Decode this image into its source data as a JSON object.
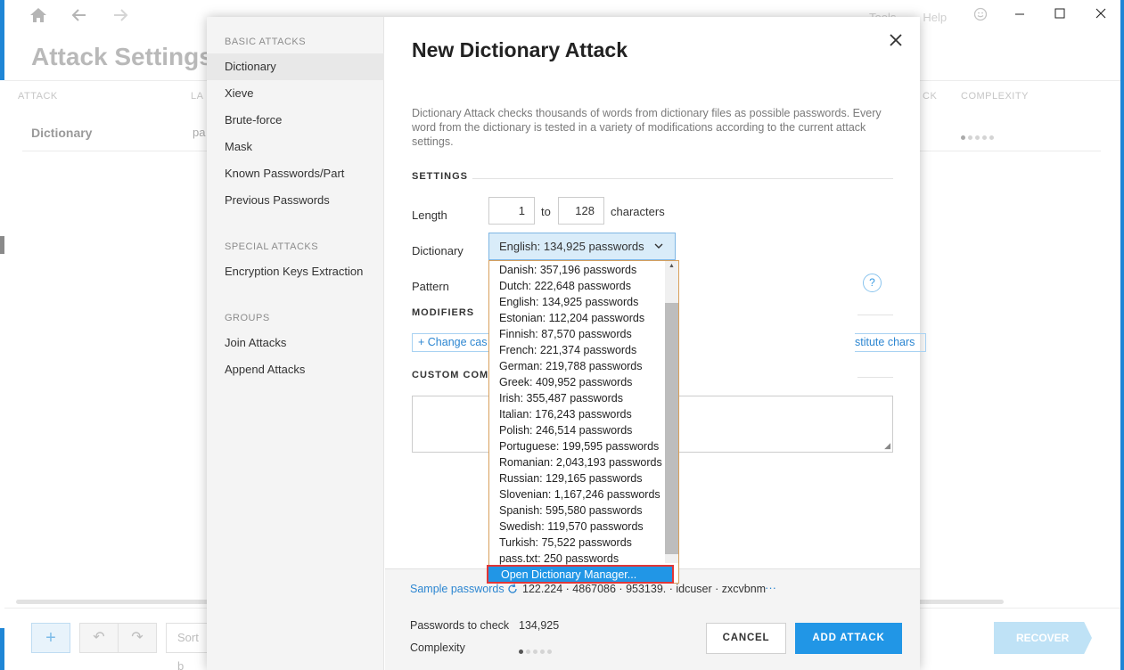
{
  "background": {
    "title": "Attack Settings",
    "menu": [
      "Tools",
      "Help"
    ],
    "columns": {
      "attack": "ATTACK",
      "la": "LA",
      "ck": "CK",
      "complexity": "COMPLEXITY"
    },
    "row": {
      "attack": "Dictionary",
      "pa": "pa"
    },
    "sort": "Sort b",
    "recover": "RECOVER"
  },
  "sidebar": {
    "basic_heading": "BASIC ATTACKS",
    "basic_items": [
      "Dictionary",
      "Xieve",
      "Brute-force",
      "Mask",
      "Known Passwords/Part",
      "Previous Passwords"
    ],
    "special_heading": "SPECIAL ATTACKS",
    "special_items": [
      "Encryption Keys Extraction"
    ],
    "groups_heading": "GROUPS",
    "group_items": [
      "Join Attacks",
      "Append Attacks"
    ]
  },
  "dialog": {
    "title": "New Dictionary Attack",
    "description": "Dictionary Attack checks thousands of words from dictionary files as possible passwords. Every word from the dictionary is tested in a variety of modifications according to the current attack settings.",
    "settings_heading": "SETTINGS",
    "length_label": "Length",
    "length_min": "1",
    "length_to": "to",
    "length_max": "128",
    "length_unit": "characters",
    "dictionary_label": "Dictionary",
    "dictionary_selected": "English: 134,925 passwords",
    "pattern_label": "Pattern",
    "pattern_help": "?",
    "modifiers_heading": "MODIFIERS",
    "modifier_change_case": "+ Change cas",
    "modifier_substitute": "stitute chars",
    "custom_heading": "CUSTOM COMI",
    "dropdown_options": [
      "Danish: 357,196 passwords",
      "Dutch: 222,648 passwords",
      "English: 134,925 passwords",
      "Estonian: 112,204 passwords",
      "Finnish: 87,570 passwords",
      "French: 221,374 passwords",
      "German: 219,788 passwords",
      "Greek: 409,952 passwords",
      "Irish: 355,487 passwords",
      "Italian: 176,243 passwords",
      "Polish: 246,514 passwords",
      "Portuguese: 199,595 passwords",
      "Romanian: 2,043,193 passwords",
      "Russian: 129,165 passwords",
      "Slovenian: 1,167,246 passwords",
      "Spanish: 595,580 passwords",
      "Swedish: 119,570 passwords",
      "Turkish: 75,522 passwords",
      "pass.txt: 250 passwords"
    ],
    "dropdown_manager": "Open Dictionary Manager...",
    "sample_label": "Sample passwords",
    "sample_values": "122.224 · 4867086 · 953139. · idcuser · zxcvbnm",
    "sample_more": "···",
    "passwords_to_check_label": "Passwords to check",
    "passwords_to_check_value": "134,925",
    "complexity_label": "Complexity",
    "complexity_level": 1,
    "complexity_max": 5,
    "cancel": "CANCEL",
    "add_attack": "ADD ATTACK"
  },
  "colors": {
    "accent": "#2196e6",
    "highlight_border": "#e23636",
    "dropdown_border": "#d9a05b"
  }
}
